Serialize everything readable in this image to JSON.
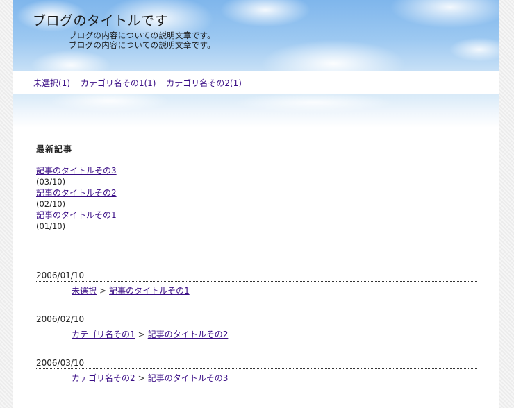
{
  "header": {
    "title": "ブログのタイトルです",
    "description_lines": [
      "ブログの内容についての説明文章です。",
      "ブログの内容についての説明文章です。"
    ]
  },
  "category_nav": [
    {
      "label": "未選択(1)"
    },
    {
      "label": "カテゴリ名その1(1)"
    },
    {
      "label": "カテゴリ名その2(1)"
    }
  ],
  "recent_articles": {
    "heading": "最新記事",
    "items": [
      {
        "title": "記事のタイトルその3",
        "date": "(03/10)"
      },
      {
        "title": "記事のタイトルその2",
        "date": "(02/10)"
      },
      {
        "title": "記事のタイトルその1",
        "date": "(01/10)"
      }
    ]
  },
  "entries": [
    {
      "date": "2006/01/10",
      "category": "未選択",
      "separator": ">",
      "title": "記事のタイトルその1"
    },
    {
      "date": "2006/02/10",
      "category": "カテゴリ名その1",
      "separator": ">",
      "title": "記事のタイトルその2"
    },
    {
      "date": "2006/03/10",
      "category": "カテゴリ名その2",
      "separator": ">",
      "title": "記事のタイトルその3"
    }
  ],
  "colors": {
    "link": "#3b0f86",
    "sky": "#9cc8f1",
    "background_stripe": "#ececec"
  }
}
